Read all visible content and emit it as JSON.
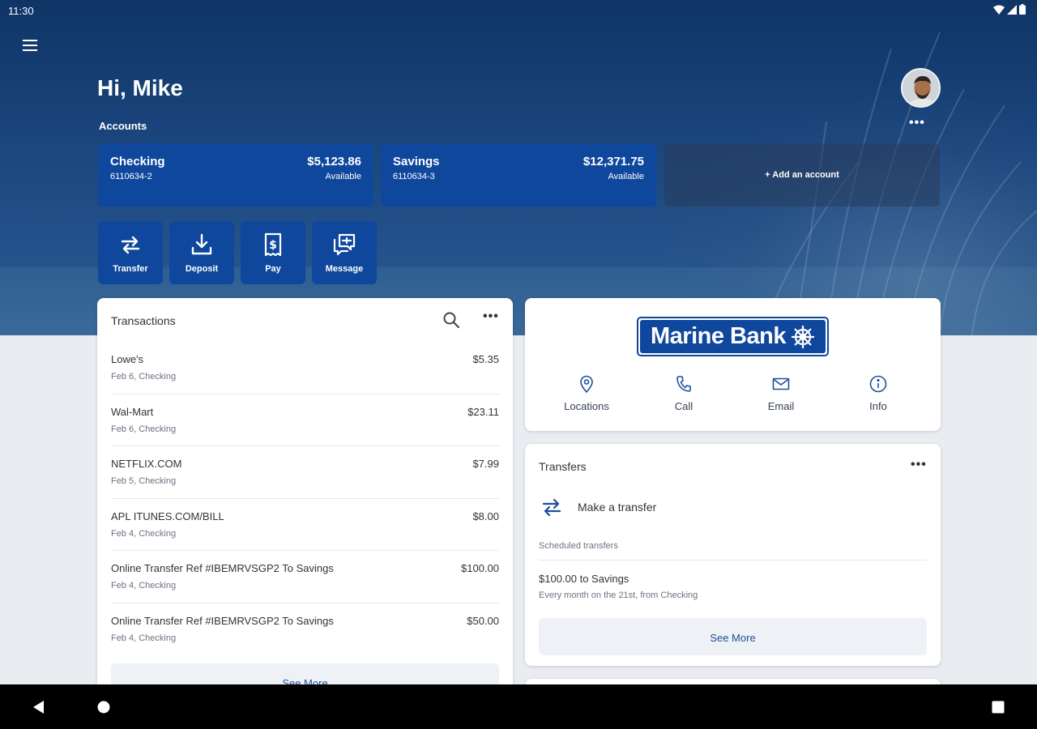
{
  "status": {
    "time": "11:30"
  },
  "header": {
    "greeting": "Hi, Mike",
    "accounts_label": "Accounts",
    "more_label": "•••"
  },
  "accounts": [
    {
      "name": "Checking",
      "number": "6110634-2",
      "balance": "$5,123.86",
      "balance_label": "Available"
    },
    {
      "name": "Savings",
      "number": "6110634-3",
      "balance": "$12,371.75",
      "balance_label": "Available"
    }
  ],
  "add_account": "+ Add an account",
  "actions": [
    {
      "label": "Transfer",
      "icon": "transfer-icon"
    },
    {
      "label": "Deposit",
      "icon": "deposit-icon"
    },
    {
      "label": "Pay",
      "icon": "pay-icon"
    },
    {
      "label": "Message",
      "icon": "message-icon"
    }
  ],
  "transactions": {
    "title": "Transactions",
    "more": "•••",
    "items": [
      {
        "name": "Lowe's",
        "sub": "Feb 6, Checking",
        "amount": "$5.35"
      },
      {
        "name": "Wal-Mart",
        "sub": "Feb 6, Checking",
        "amount": "$23.11"
      },
      {
        "name": "NETFLIX.COM",
        "sub": "Feb 5, Checking",
        "amount": "$7.99"
      },
      {
        "name": "APL ITUNES.COM/BILL",
        "sub": "Feb 4, Checking",
        "amount": "$8.00"
      },
      {
        "name": "Online Transfer Ref #IBEMRVSGP2 To Savings",
        "sub": "Feb 4, Checking",
        "amount": "$100.00"
      },
      {
        "name": "Online Transfer Ref #IBEMRVSGP2 To Savings",
        "sub": "Feb 4, Checking",
        "amount": "$50.00"
      }
    ],
    "see_more": "See More"
  },
  "bank": {
    "name": "Marine Bank",
    "contacts": [
      {
        "label": "Locations",
        "icon": "location-pin-icon"
      },
      {
        "label": "Call",
        "icon": "phone-icon"
      },
      {
        "label": "Email",
        "icon": "email-icon"
      },
      {
        "label": "Info",
        "icon": "info-icon"
      }
    ]
  },
  "transfers": {
    "title": "Transfers",
    "more": "•••",
    "make_transfer": "Make a transfer",
    "scheduled_label": "Scheduled transfers",
    "scheduled": {
      "title": "$100.00 to Savings",
      "sub": "Every month on the 21st, from Checking"
    },
    "see_more": "See More"
  },
  "colors": {
    "primary": "#0f479c",
    "hero": "#1a447c",
    "page_bg": "#e9ecf1",
    "link": "#1f4f9a"
  }
}
